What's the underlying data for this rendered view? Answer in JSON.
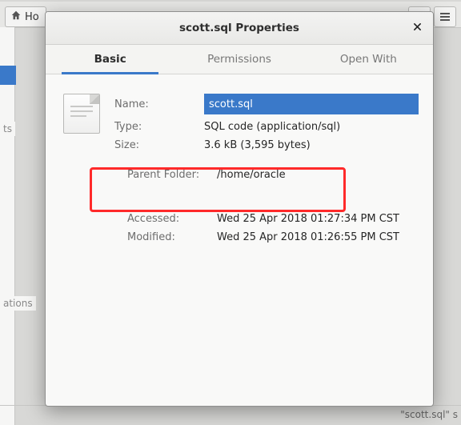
{
  "bg": {
    "home_label": "Ho",
    "side_label_1": "ts",
    "side_label_2": "ations",
    "status": "\"scott.sql\" s"
  },
  "dialog": {
    "title": "scott.sql Properties",
    "tabs": {
      "basic": "Basic",
      "permissions": "Permissions",
      "open_with": "Open With"
    },
    "labels": {
      "name": "Name:",
      "type": "Type:",
      "size": "Size:",
      "parent": "Parent Folder:",
      "accessed": "Accessed:",
      "modified": "Modified:"
    },
    "values": {
      "name": "scott.sql",
      "type": "SQL code (application/sql)",
      "size": "3.6 kB (3,595 bytes)",
      "parent": "/home/oracle",
      "accessed": "Wed 25 Apr 2018 01:27:34 PM CST",
      "modified": "Wed 25 Apr 2018 01:26:55 PM CST"
    }
  }
}
